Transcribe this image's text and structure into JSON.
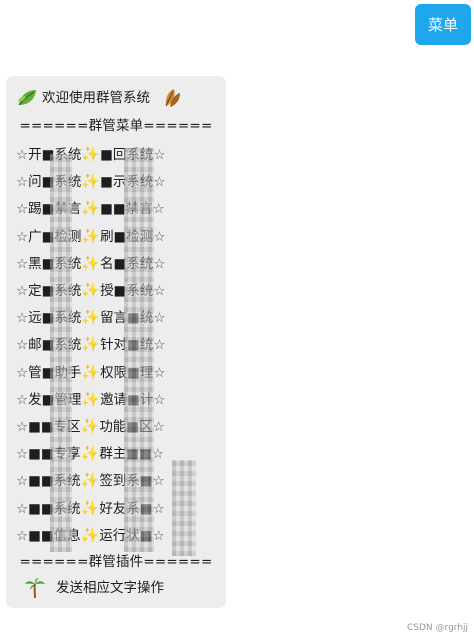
{
  "header": {
    "menu_button": "菜单"
  },
  "bubble": {
    "welcome": "欢迎使用群管系统",
    "menu_title": "======群管菜单======",
    "rows": [
      {
        "left": "开■系统",
        "right": "■回系统"
      },
      {
        "left": "问■系统",
        "right": "■示系统"
      },
      {
        "left": "踢■禁言",
        "right": "■■禁言"
      },
      {
        "left": "广■检测",
        "right": "刷■检测"
      },
      {
        "left": "黑■系统",
        "right": "名■系统"
      },
      {
        "left": "定■系统",
        "right": "授■系统"
      },
      {
        "left": "远■系统",
        "right": "留言■统"
      },
      {
        "left": "邮■系统",
        "right": "针对■统"
      },
      {
        "left": "管■助手",
        "right": "权限■理"
      },
      {
        "left": "发■管理",
        "right": "邀请■计"
      },
      {
        "left": "■■专区",
        "right": "功能■区"
      },
      {
        "left": "■■专享",
        "right": "群主■■"
      },
      {
        "left": "■■系统",
        "right": "签到系■"
      },
      {
        "left": "■■系统",
        "right": "好友系■"
      },
      {
        "left": "■■信息",
        "right": "运行状■"
      }
    ],
    "plugin_title": "======群管插件======",
    "footer": "发送相应文字操作"
  },
  "watermark": "CSDN @rgrhjj",
  "colors": {
    "button": "#1fa7ee",
    "bubble": "#ededed"
  }
}
